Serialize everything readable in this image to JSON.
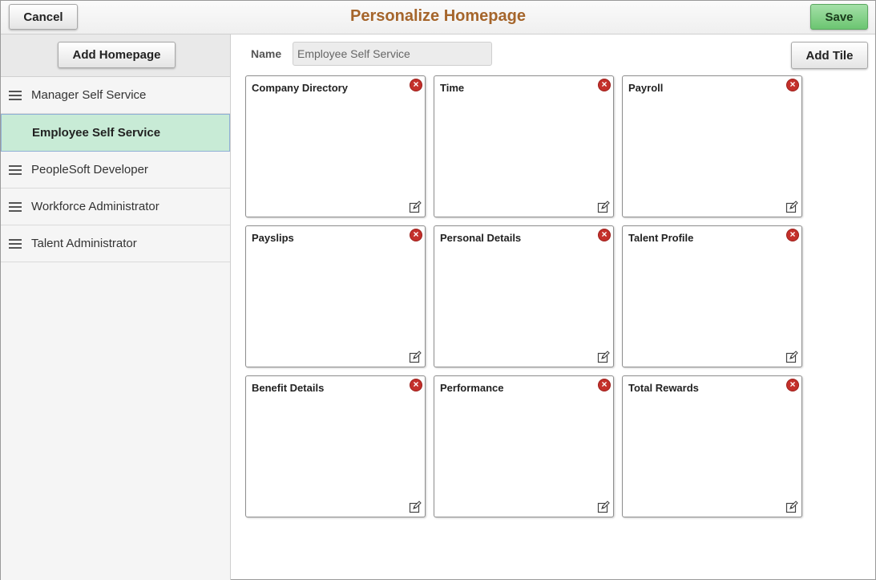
{
  "header": {
    "title": "Personalize Homepage",
    "cancel_label": "Cancel",
    "save_label": "Save"
  },
  "sidebar": {
    "add_homepage_label": "Add Homepage",
    "items": [
      {
        "label": "Manager Self Service",
        "active": false
      },
      {
        "label": "Employee Self Service",
        "active": true
      },
      {
        "label": "PeopleSoft Developer",
        "active": false
      },
      {
        "label": "Workforce Administrator",
        "active": false
      },
      {
        "label": "Talent Administrator",
        "active": false
      }
    ]
  },
  "main": {
    "name_label": "Name",
    "name_value": "Employee Self Service",
    "add_tile_label": "Add Tile",
    "tiles": [
      {
        "title": "Company Directory"
      },
      {
        "title": "Time"
      },
      {
        "title": "Payroll"
      },
      {
        "title": "Payslips"
      },
      {
        "title": "Personal Details"
      },
      {
        "title": "Talent Profile"
      },
      {
        "title": "Benefit Details"
      },
      {
        "title": "Performance"
      },
      {
        "title": "Total Rewards"
      }
    ]
  },
  "colors": {
    "title": "#a5652b",
    "save": "#6cc571",
    "active_item": "#c8ebd6",
    "remove_icon": "#c4302b"
  },
  "icons": {
    "remove": "close-circle-icon",
    "edit": "edit-icon",
    "drag": "drag-handle-icon"
  }
}
